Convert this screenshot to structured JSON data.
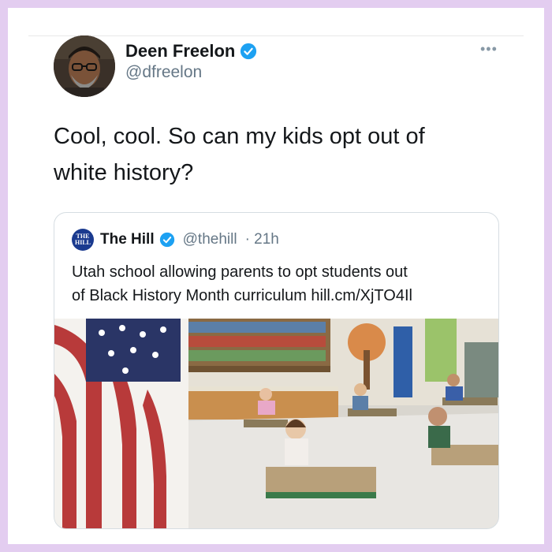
{
  "tweet": {
    "display_name": "Deen Freelon",
    "handle": "@dfreelon",
    "more_icon": "more-icon",
    "text_line1": "Cool, cool. So can my kids opt out of",
    "text_line2": "white history?"
  },
  "quoted_tweet": {
    "logo_line1": "THE",
    "logo_line2": "HILL",
    "display_name": "The Hill",
    "handle": "@thehill",
    "time": "· 21h",
    "text_line1": "Utah school allowing parents to opt students out",
    "text_line2": "of Black History Month curriculum hill.cm/XjTO4Il"
  },
  "colors": {
    "border": "#e3cdf0",
    "verified": "#1da1f2",
    "text": "#14171a",
    "secondary": "#657786"
  }
}
